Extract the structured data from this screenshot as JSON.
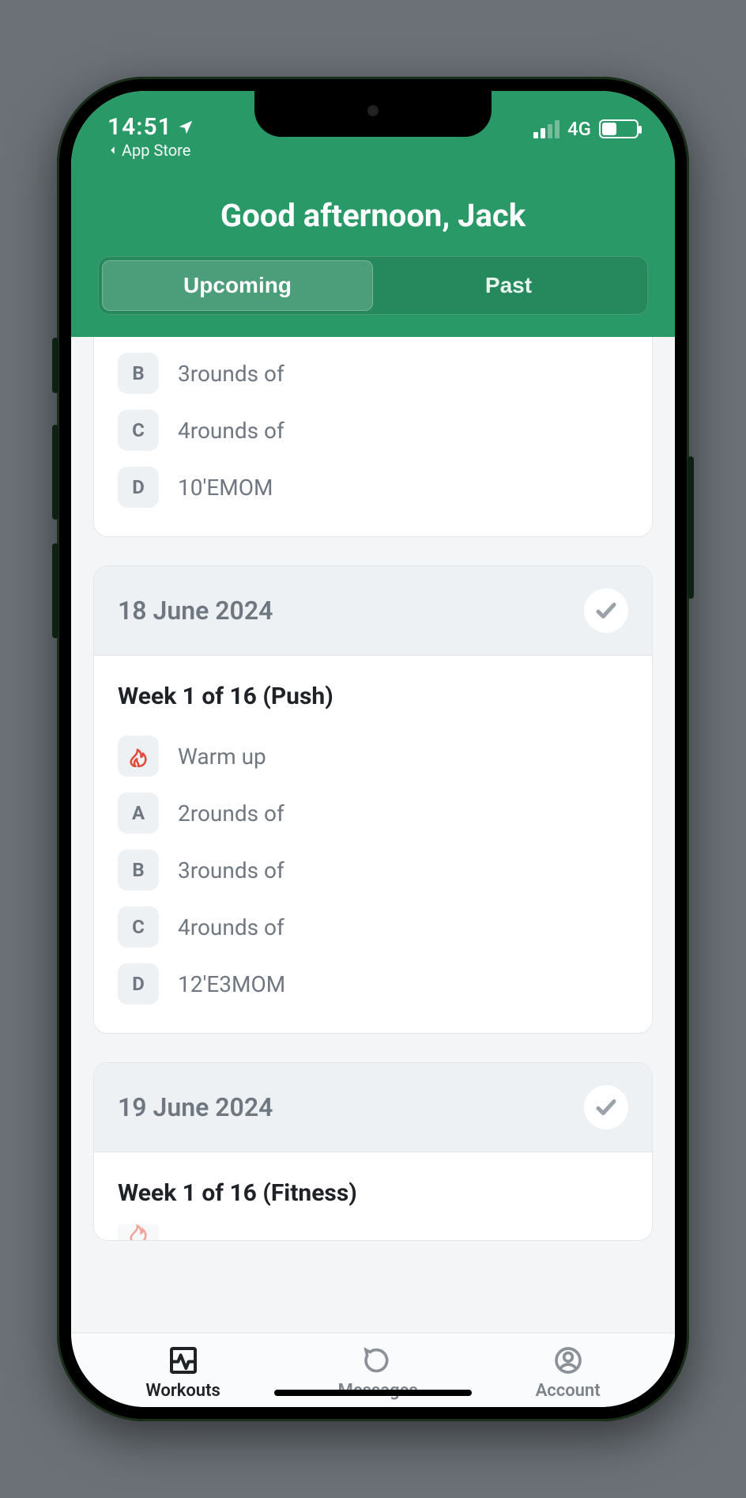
{
  "status": {
    "time": "14:51",
    "back_app": "App Store",
    "network": "4G"
  },
  "header": {
    "greeting": "Good afternoon, Jack",
    "tabs": {
      "upcoming": "Upcoming",
      "past": "Past"
    }
  },
  "workouts": [
    {
      "date": "",
      "title": "",
      "truncated_top": true,
      "blocks": [
        {
          "badge": "B",
          "label": "3rounds of"
        },
        {
          "badge": "C",
          "label": "4rounds of"
        },
        {
          "badge": "D",
          "label": "10'EMOM"
        }
      ]
    },
    {
      "date": "18 June 2024",
      "title": "Week 1 of 16 (Push)",
      "blocks": [
        {
          "badge": "flame",
          "label": "Warm up"
        },
        {
          "badge": "A",
          "label": "2rounds of"
        },
        {
          "badge": "B",
          "label": "3rounds of"
        },
        {
          "badge": "C",
          "label": "4rounds of"
        },
        {
          "badge": "D",
          "label": "12'E3MOM"
        }
      ]
    },
    {
      "date": "19 June 2024",
      "title": "Week 1 of 16 (Fitness)",
      "truncated_bottom": true,
      "blocks": []
    }
  ],
  "nav": {
    "workouts": "Workouts",
    "messages": "Messages",
    "account": "Account"
  }
}
